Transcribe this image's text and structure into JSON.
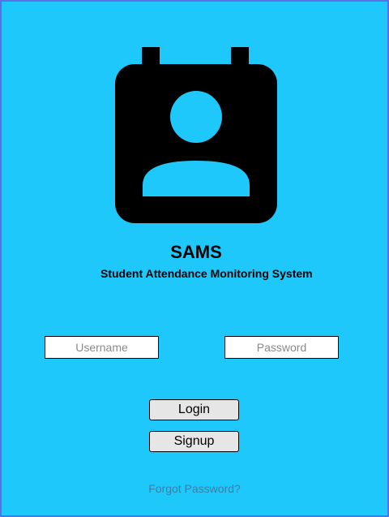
{
  "app": {
    "title": "SAMS",
    "subtitle": "Student Attendance Monitoring System",
    "logo_icon": "contact-calendar-icon"
  },
  "login_form": {
    "username_placeholder": "Username",
    "username_value": "",
    "password_placeholder": "Password",
    "password_value": "",
    "login_label": "Login",
    "signup_label": "Signup",
    "forgot_label": "Forgot Password?"
  },
  "colors": {
    "background": "#1ec8fb",
    "border": "#5a6ee6",
    "button_bg": "#e6e6e6",
    "link": "#3a7fa6"
  }
}
